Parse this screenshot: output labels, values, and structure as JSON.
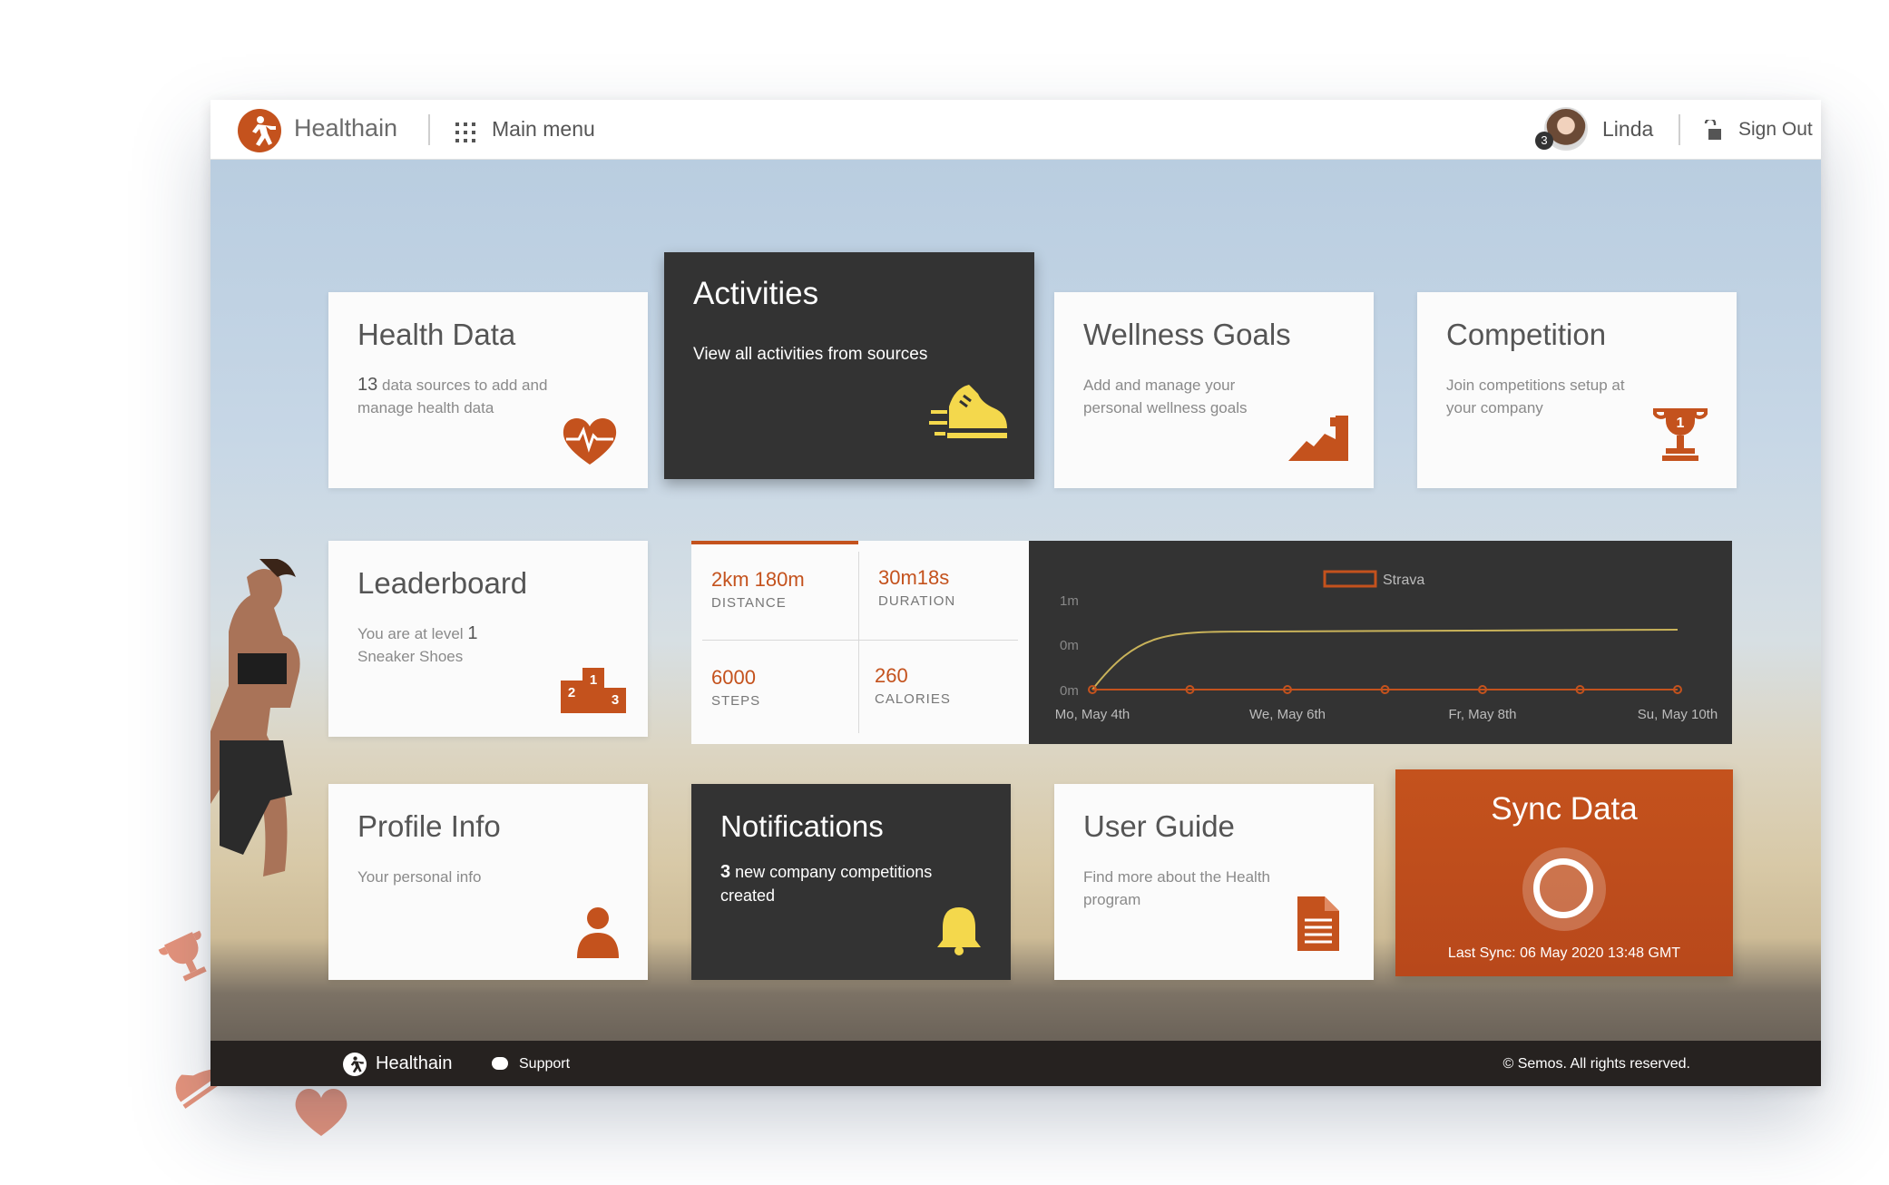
{
  "header": {
    "brand": "Healthain",
    "menu_label": "Main menu",
    "user_name": "Linda",
    "user_badge": "3",
    "signout_label": "Sign Out"
  },
  "tiles": {
    "health_data": {
      "title": "Health Data",
      "count": "13",
      "desc": "data sources to add and manage health data"
    },
    "activities": {
      "title": "Activities",
      "desc": "View all activities from sources"
    },
    "wellness": {
      "title": "Wellness Goals",
      "desc": "Add and manage your personal wellness goals"
    },
    "competition": {
      "title": "Competition",
      "desc": "Join competitions setup at your company",
      "trophy_num": "1"
    },
    "leaderboard": {
      "title": "Leaderboard",
      "desc_prefix": "You are at level",
      "level": "1",
      "desc_suffix": "Sneaker Shoes",
      "podium": [
        "1",
        "2",
        "3"
      ]
    },
    "profile": {
      "title": "Profile Info",
      "desc": "Your personal info"
    },
    "notifications": {
      "title": "Notifications",
      "count": "3",
      "desc": "new company competitions created"
    },
    "user_guide": {
      "title": "User Guide",
      "desc": "Find more about the Health program"
    }
  },
  "stats": [
    {
      "value": "2km 180m",
      "label": "DISTANCE"
    },
    {
      "value": "30m18s",
      "label": "DURATION"
    },
    {
      "value": "6000",
      "label": "STEPS"
    },
    {
      "value": "260",
      "label": "CALORIES"
    }
  ],
  "chart_data": {
    "type": "line",
    "legend": [
      "Strava"
    ],
    "y_ticks": [
      "1m",
      "0m",
      "0m"
    ],
    "x_ticks": [
      "Mo, May 4th",
      "We, May 6th",
      "Fr, May 8th",
      "Su, May 10th"
    ],
    "series": [
      {
        "name": "Strava",
        "values": [
          0,
          0,
          0,
          0,
          0,
          0,
          0
        ]
      }
    ],
    "colors": {
      "series": "#c4521d",
      "trend": "#c9b35a",
      "background": "#333333"
    }
  },
  "sync": {
    "title": "Sync Data",
    "last_sync": "Last Sync: 06 May 2020 13:48 GMT"
  },
  "footer": {
    "brand": "Healthain",
    "support": "Support",
    "copyright": "© Semos. All rights reserved."
  },
  "colors": {
    "accent": "#c4521d",
    "dark_tile": "#333333",
    "notification_bell": "#f4d84c"
  }
}
